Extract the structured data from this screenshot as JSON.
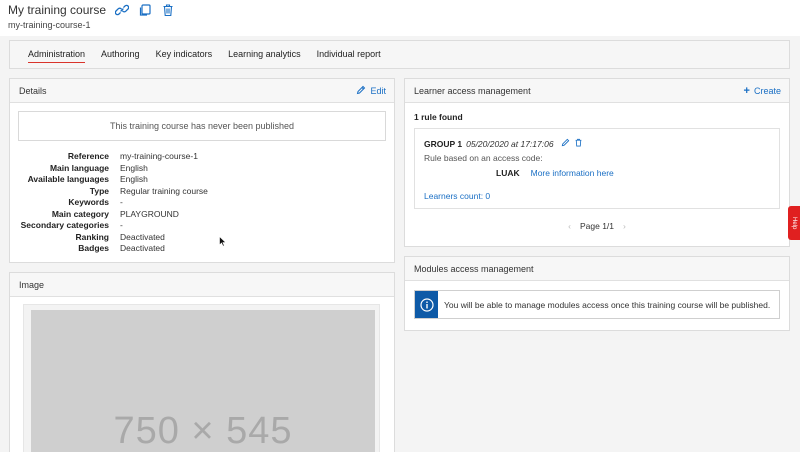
{
  "header": {
    "title": "My training course",
    "subtitle": "my-training-course-1",
    "icons": [
      "link-icon",
      "copy-icon",
      "trash-icon"
    ]
  },
  "tabs": [
    {
      "label": "Administration",
      "active": true
    },
    {
      "label": "Authoring",
      "active": false
    },
    {
      "label": "Key indicators",
      "active": false
    },
    {
      "label": "Learning analytics",
      "active": false
    },
    {
      "label": "Individual report",
      "active": false
    }
  ],
  "details": {
    "title": "Details",
    "edit_label": "Edit",
    "notice": "This training course has never been published",
    "rows": [
      {
        "key": "Reference",
        "value": "my-training-course-1"
      },
      {
        "key": "Main language",
        "value": "English"
      },
      {
        "key": "Available languages",
        "value": "English"
      },
      {
        "key": "Type",
        "value": "Regular training course"
      },
      {
        "key": "Keywords",
        "value": "-"
      },
      {
        "key": "Main category",
        "value": "PLAYGROUND"
      },
      {
        "key": "Secondary categories",
        "value": "-"
      },
      {
        "key": "Ranking",
        "value": "Deactivated"
      },
      {
        "key": "Badges",
        "value": "Deactivated"
      }
    ]
  },
  "image": {
    "title": "Image",
    "placeholder_text": "750 × 545"
  },
  "learner_access": {
    "title": "Learner access management",
    "create_label": "Create",
    "count_text": "1 rule found",
    "rule": {
      "group": "GROUP 1",
      "date": "05/20/2020 at 17:17:06",
      "description": "Rule based on an access code:",
      "code": "LUAK",
      "more_info": "More information here",
      "learners_count": "Learners count: 0"
    },
    "pager": {
      "label": "Page 1/1",
      "prev": "‹",
      "next": "›"
    }
  },
  "modules_access": {
    "title": "Modules access management",
    "info": "You will be able to manage modules access once this training course will be published."
  },
  "help": {
    "label": "Help"
  },
  "colors": {
    "accent": "#1a6fc4",
    "active_tab_underline": "#d9342b",
    "info_icon_bg": "#0e5aa7",
    "help_tab": "#e02020"
  }
}
